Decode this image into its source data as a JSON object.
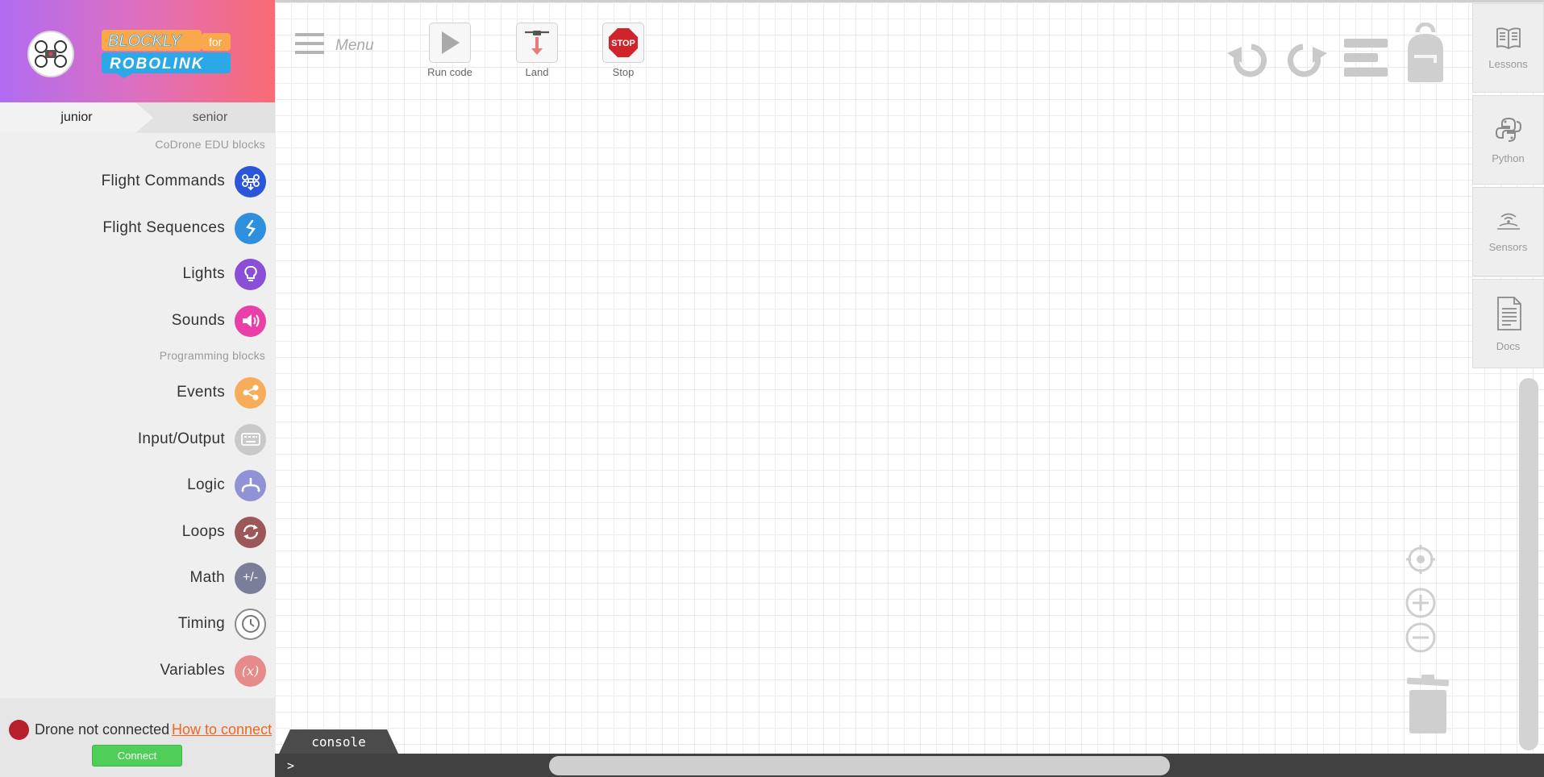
{
  "brand": {
    "logo_line1": "BLOCKLY",
    "logo_for": "for",
    "logo_line2": "ROBOLINK"
  },
  "level_tabs": [
    {
      "label": "junior",
      "selected": true
    },
    {
      "label": "senior",
      "selected": false
    }
  ],
  "sections": {
    "codrone": "CoDrone EDU blocks",
    "programming": "Programming blocks"
  },
  "categories": [
    {
      "label": "Flight Commands",
      "color": "#2b56d9",
      "icon": "drone-icon"
    },
    {
      "label": "Flight Sequences",
      "color": "#2e8fde",
      "icon": "sequence-icon"
    },
    {
      "label": "Lights",
      "color": "#8a4fd6",
      "icon": "lightbulb-icon"
    },
    {
      "label": "Sounds",
      "color": "#ea3fa8",
      "icon": "speaker-icon"
    },
    {
      "label": "Events",
      "color": "#f6ac59",
      "icon": "share-icon"
    },
    {
      "label": "Input/Output",
      "color": "#c9c9c9",
      "icon": "keyboard-icon"
    },
    {
      "label": "Logic",
      "color": "#8f92d4",
      "icon": "logic-icon"
    },
    {
      "label": "Loops",
      "color": "#9c5858",
      "icon": "loop-icon"
    },
    {
      "label": "Math",
      "color": "#7b7e99",
      "icon": "math-icon",
      "glyph": "+/-"
    },
    {
      "label": "Timing",
      "color": "#ffffff",
      "icon": "clock-icon"
    },
    {
      "label": "Variables",
      "color": "#e68a8a",
      "icon": "variable-icon",
      "glyph": "(x)"
    }
  ],
  "connection": {
    "status": "Drone not connected",
    "link": "How to connect",
    "button": "Connect"
  },
  "toolbar": {
    "menu": "Menu",
    "run": "Run code",
    "land": "Land",
    "stop": "Stop",
    "stop_sign": "STOP"
  },
  "side_tabs": [
    {
      "label": "Lessons",
      "icon": "book-icon"
    },
    {
      "label": "Python",
      "icon": "python-icon"
    },
    {
      "label": "Sensors",
      "icon": "sensor-icon"
    },
    {
      "label": "Docs",
      "icon": "document-icon"
    }
  ],
  "console": {
    "tab": "console",
    "prompt": ">"
  }
}
